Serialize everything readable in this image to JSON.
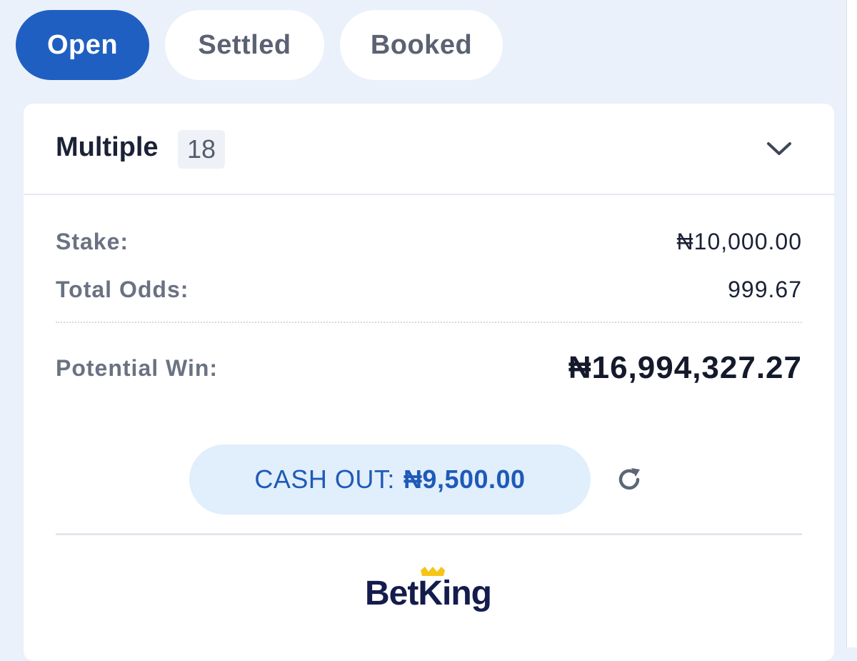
{
  "tabs": [
    {
      "label": "Open",
      "active": true
    },
    {
      "label": "Settled",
      "active": false
    },
    {
      "label": "Booked",
      "active": false
    }
  ],
  "bet": {
    "type": "Multiple",
    "count": "18"
  },
  "details": {
    "stake_label": "Stake:",
    "stake_value": "₦10,000.00",
    "odds_label": "Total Odds:",
    "odds_value": "999.67",
    "win_label": "Potential Win:",
    "win_value": "₦16,994,327.27"
  },
  "cashout": {
    "label": "CASH OUT:",
    "amount": "₦9,500.00"
  },
  "brand": {
    "name": "BetKing"
  },
  "icons": {
    "expand": "chevron-down-icon",
    "refresh": "refresh-icon",
    "logo_crown": "crown-icon"
  },
  "colors": {
    "accent": "#1f5fc2",
    "page_bg": "#ebf1fa",
    "cashout_bg": "#e1eefb",
    "brand_navy": "#141b4d",
    "brand_gold": "#f5c518"
  }
}
